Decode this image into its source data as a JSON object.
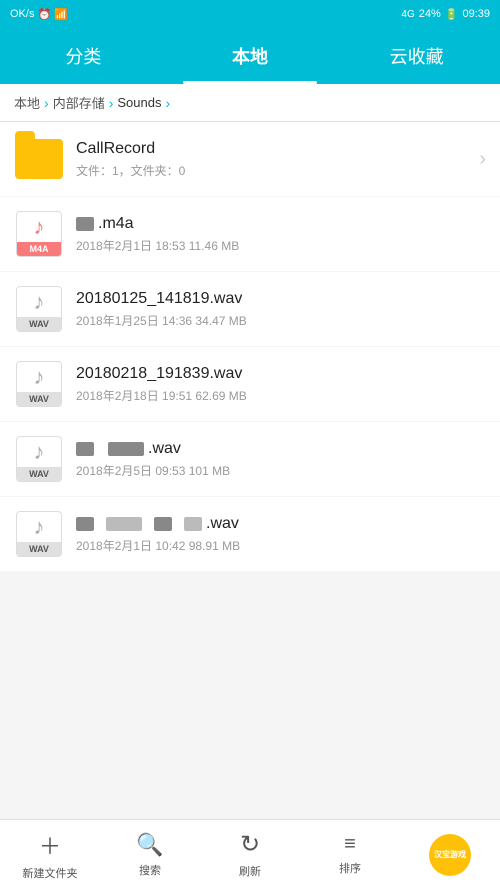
{
  "statusBar": {
    "signal": "OK/s",
    "time": "09:39",
    "battery": "24%",
    "network": "4G"
  },
  "tabs": [
    {
      "id": "fenlei",
      "label": "分类",
      "active": false
    },
    {
      "id": "bendi",
      "label": "本地",
      "active": true
    },
    {
      "id": "yunshoucang",
      "label": "云收藏",
      "active": false
    }
  ],
  "breadcrumb": {
    "items": [
      "本地",
      "内部存储",
      "Sounds"
    ]
  },
  "files": [
    {
      "id": "callrecord",
      "type": "folder",
      "name": "CallRecord",
      "meta": "文件：1，文件夹：0",
      "hasArrow": true
    },
    {
      "id": "m4a-file",
      "type": "m4a",
      "namePrefix": "redact",
      "nameExt": ".m4a",
      "meta": "2018年2月1日 18:53 11.46 MB",
      "hasArrow": false
    },
    {
      "id": "wav-file-1",
      "type": "wav",
      "name": "20180125_141819.wav",
      "meta": "2018年1月25日 14:36 34.47 MB",
      "hasArrow": false
    },
    {
      "id": "wav-file-2",
      "type": "wav",
      "name": "20180218_191839.wav",
      "meta": "2018年2月18日 19:51 62.69 MB",
      "hasArrow": false
    },
    {
      "id": "wav-file-3",
      "type": "wav",
      "namePrefix": "redact2",
      "nameExt": ".wav",
      "meta": "2018年2月5日 09:53 101 MB",
      "hasArrow": false
    },
    {
      "id": "wav-file-4",
      "type": "wav",
      "namePrefix": "redact3",
      "nameExt": ".wav",
      "meta": "2018年2月1日 10:42 98.91 MB",
      "hasArrow": false
    }
  ],
  "bottomNav": [
    {
      "id": "new-folder",
      "icon": "+",
      "label": "新建文件夹"
    },
    {
      "id": "search",
      "icon": "🔍",
      "label": "搜索"
    },
    {
      "id": "refresh",
      "icon": "↻",
      "label": "刷新"
    },
    {
      "id": "sort",
      "icon": "≡",
      "label": "排序"
    },
    {
      "id": "brand",
      "icon": "汉宝游戏",
      "label": ""
    }
  ]
}
